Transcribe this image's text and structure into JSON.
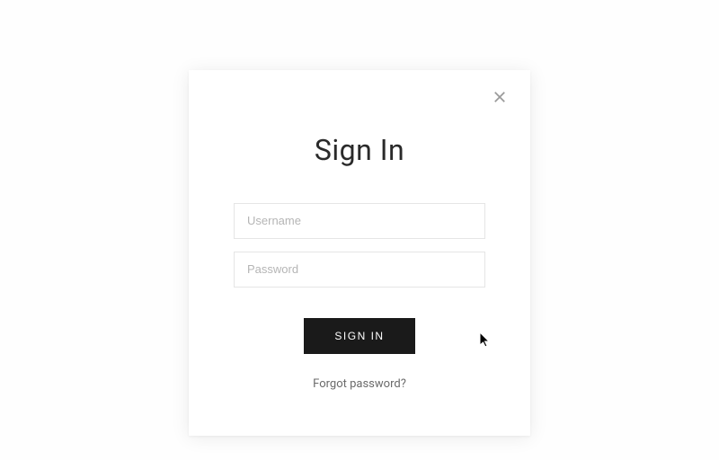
{
  "modal": {
    "title": "Sign In",
    "username_placeholder": "Username",
    "password_placeholder": "Password",
    "submit_label": "SIGN IN",
    "forgot_label": "Forgot password?"
  }
}
